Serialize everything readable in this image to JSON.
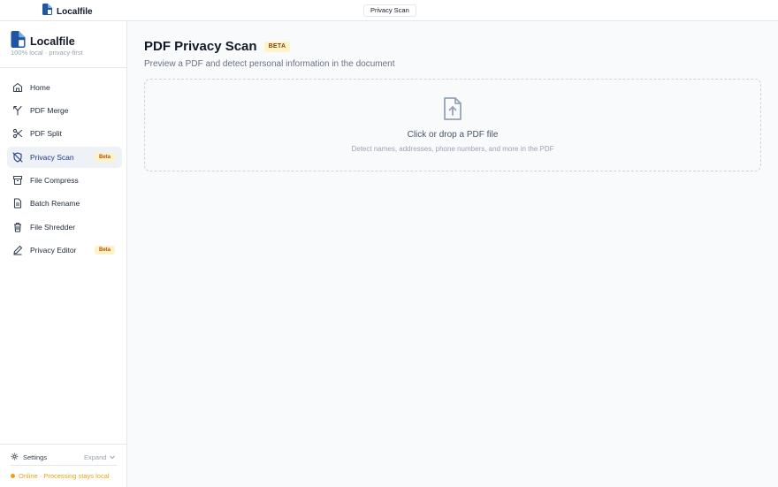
{
  "topbar": {
    "app_name": "Localfile",
    "active_tab": "Privacy Scan"
  },
  "sidebar": {
    "brand": "Localfile",
    "tagline": "100% local · privacy-first",
    "items": [
      {
        "label": "Home",
        "icon": "home-icon"
      },
      {
        "label": "PDF Merge",
        "icon": "merge-icon"
      },
      {
        "label": "PDF Split",
        "icon": "scissors-icon"
      },
      {
        "label": "Privacy Scan",
        "icon": "shield-off-icon",
        "badge": "Beta",
        "active": true
      },
      {
        "label": "File Compress",
        "icon": "archive-icon"
      },
      {
        "label": "Batch Rename",
        "icon": "file-text-icon"
      },
      {
        "label": "File Shredder",
        "icon": "trash-icon"
      },
      {
        "label": "Privacy Editor",
        "icon": "pen-icon",
        "badge": "Beta"
      }
    ],
    "settings_label": "Settings",
    "expand_label": "Expand",
    "status_text": "Online · Processing stays local"
  },
  "main": {
    "title": "PDF Privacy Scan",
    "title_badge": "BETA",
    "subtitle": "Preview a PDF and detect personal information in the document",
    "dropzone": {
      "primary": "Click or drop a PDF file",
      "hint": "Detect names, addresses, phone numbers, and more in the PDF",
      "icon": "file-upload-icon"
    }
  },
  "colors": {
    "brand": "#1e56a0",
    "beta_bg": "#fef3c7",
    "beta_text": "#b45309",
    "status": "#f59e0b",
    "active_bg": "#eef2f7"
  }
}
